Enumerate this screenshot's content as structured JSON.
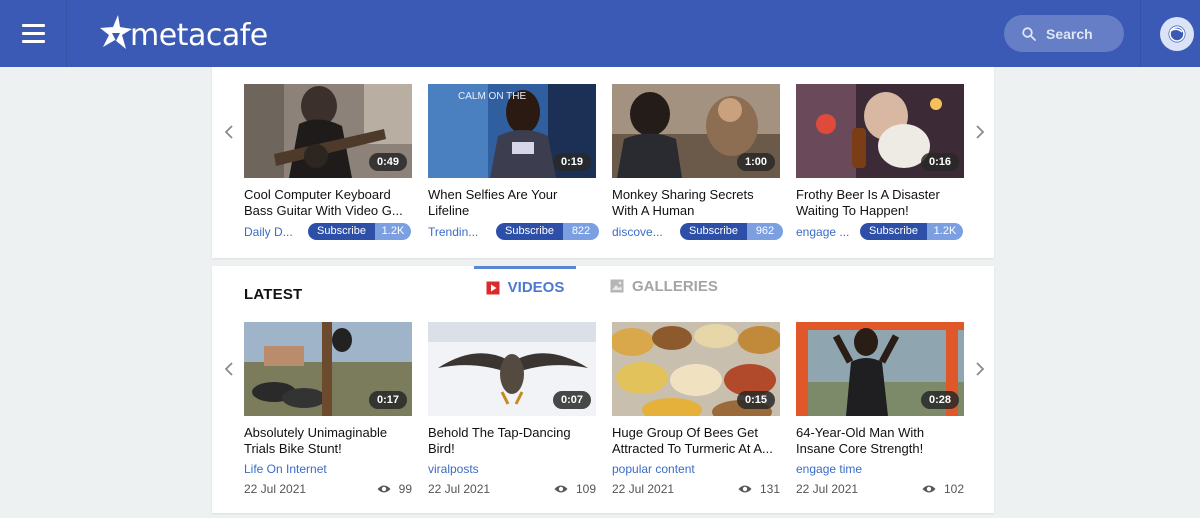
{
  "header": {
    "logo_text": "metacafe",
    "search_label": "Search",
    "brand_color": "#3a5ab5"
  },
  "icons": {
    "menu": "hamburger-icon",
    "search": "search-icon",
    "user": "user-icon",
    "prev": "chevron-left-icon",
    "next": "chevron-right-icon",
    "views": "eye-icon",
    "videos_tab": "play-icon",
    "galleries_tab": "image-icon"
  },
  "trending": {
    "subscribe_label": "Subscribe",
    "videos": [
      {
        "title": "Cool Computer Keyboard Bass Guitar With Video G...",
        "duration": "0:49",
        "channel": "Daily D...",
        "subscribers": "1.2K"
      },
      {
        "title": "When Selfies Are Your Lifeline",
        "duration": "0:19",
        "channel": "Trendin...",
        "subscribers": "822"
      },
      {
        "title": "Monkey Sharing Secrets With A Human",
        "duration": "1:00",
        "channel": "discove...",
        "subscribers": "962"
      },
      {
        "title": "Frothy Beer Is A Disaster Waiting To Happen!",
        "duration": "0:16",
        "channel": "engage ...",
        "subscribers": "1.2K"
      }
    ]
  },
  "latest": {
    "heading": "LATEST",
    "tabs": [
      {
        "label": "VIDEOS",
        "active": true
      },
      {
        "label": "GALLERIES",
        "active": false
      }
    ],
    "videos": [
      {
        "title": "Absolutely Unimaginable Trials Bike Stunt!",
        "duration": "0:17",
        "channel": "Life On Internet",
        "date": "22 Jul 2021",
        "views": "99"
      },
      {
        "title": "Behold The Tap-Dancing Bird!",
        "duration": "0:07",
        "channel": "viralposts",
        "date": "22 Jul 2021",
        "views": "109"
      },
      {
        "title": "Huge Group Of Bees Get Attracted To Turmeric At A...",
        "duration": "0:15",
        "channel": "popular content",
        "date": "22 Jul 2021",
        "views": "131"
      },
      {
        "title": "64-Year-Old Man With Insane Core Strength!",
        "duration": "0:28",
        "channel": "engage time",
        "date": "22 Jul 2021",
        "views": "102"
      }
    ]
  }
}
